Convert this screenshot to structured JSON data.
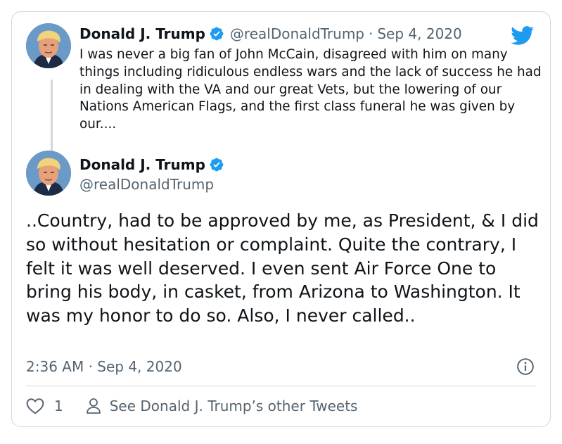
{
  "tweet1": {
    "name": "Donald J. Trump",
    "handle": "@realDonaldTrump",
    "separator": "·",
    "date": "Sep 4, 2020",
    "text": "I was never a big fan of John McCain, disagreed with him on many things including ridiculous endless wars and the lack of success he had in dealing with the VA and our great Vets, but the lowering of our Nations American Flags, and the first class funeral he was given by our...."
  },
  "tweet2": {
    "name": "Donald J. Trump",
    "handle": "@realDonaldTrump",
    "text": "..Country, had to be approved by me, as President, & I did so without hesitation  or complaint. Quite the contrary, I felt it was well deserved. I even sent Air Force One to bring his body, in casket, from Arizona to Washington. It was my honor to do so. Also, I never called..",
    "timestamp": "2:36 AM · Sep 4, 2020"
  },
  "actions": {
    "like_count": "1",
    "other_tweets_label": "See Donald J. Trump’s other Tweets"
  },
  "icons": {
    "verified": "verified-badge-icon",
    "bird": "twitter-bird-icon",
    "info": "info-icon",
    "heart": "heart-icon",
    "person": "person-icon"
  },
  "colors": {
    "brand": "#1d9bf0",
    "text": "#0f1419",
    "secondary": "#536471",
    "border": "#cfd9de"
  }
}
